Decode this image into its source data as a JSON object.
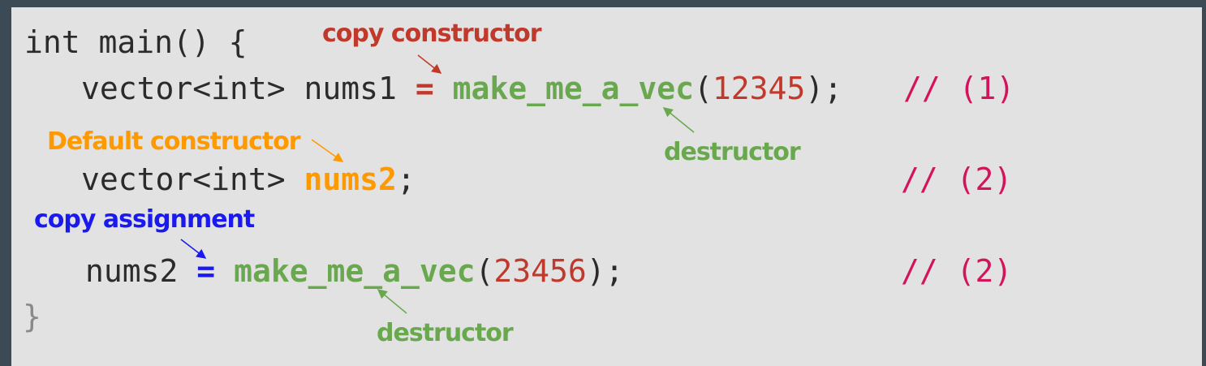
{
  "code": {
    "line1": "int main() {",
    "line2": {
      "decl": "vector<int> nums1 ",
      "op": "=",
      "fn": "make_me_a_vec",
      "open": "(",
      "arg": "12345",
      "close": ");",
      "comment": "// (1)"
    },
    "line3": {
      "decl": "vector<int> ",
      "var": "nums2",
      "end": ";",
      "comment": "// (2)"
    },
    "line4": {
      "var": "nums2 ",
      "op": "=",
      "fn": "make_me_a_vec",
      "open": "(",
      "arg": "23456",
      "close": ");",
      "comment": "// (2)"
    },
    "line5": "}"
  },
  "annotations": {
    "copy_constructor": "copy constructor",
    "destructor_1": "destructor",
    "default_constructor": "Default constructor",
    "copy_assignment": "copy assignment",
    "destructor_2": "destructor"
  },
  "colors": {
    "background": "#3c4a56",
    "panel": "#e2e2e2",
    "copy_constructor": "#c0392b",
    "destructor": "#6aa84f",
    "default_constructor": "#ff9900",
    "copy_assignment": "#1a1aee",
    "comment": "#d4145a"
  }
}
